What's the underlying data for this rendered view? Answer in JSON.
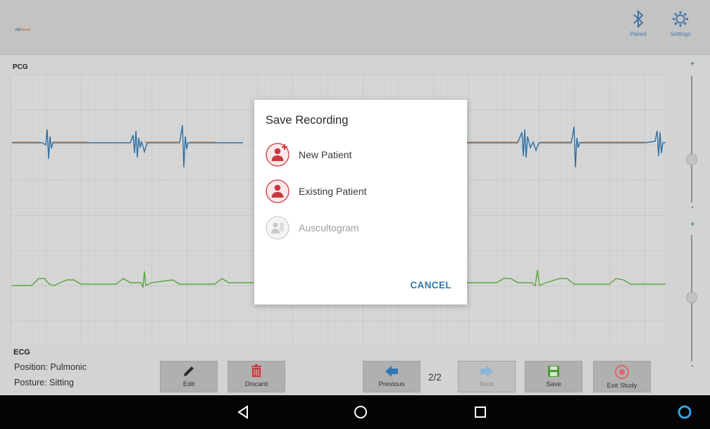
{
  "app": {
    "brand_part1": "HD",
    "brand_part2": "Steth"
  },
  "topbar": {
    "paired_label": "Paired",
    "settings_label": "Settings"
  },
  "charts": {
    "pcg_label": "PCG",
    "ecg_label": "ECG"
  },
  "info": {
    "position": "Position: Pulmonic",
    "posture": "Posture: Sitting"
  },
  "toolbar": {
    "edit_label": "Edit",
    "discard_label": "Discard",
    "previous_label": "Previous",
    "page_indicator": "2/2",
    "next_label": "Next",
    "save_label": "Save",
    "exit_label": "Exit Study"
  },
  "sliders": {
    "plus": "+",
    "minus": "-"
  },
  "dialog": {
    "title": "Save Recording",
    "options": [
      {
        "label": "New Patient",
        "icon": "add-patient-icon",
        "enabled": true
      },
      {
        "label": "Existing Patient",
        "icon": "patient-icon",
        "enabled": true
      },
      {
        "label": "Auscultogram",
        "icon": "auscultogram-icon",
        "enabled": false
      }
    ],
    "cancel_label": "CANCEL"
  },
  "colors": {
    "accent": "#2f78b0",
    "danger": "#c8383f",
    "pcg_blue": "#2e6fa3",
    "pcg_orange": "#d07a3a",
    "ecg_green": "#5aa53b"
  }
}
